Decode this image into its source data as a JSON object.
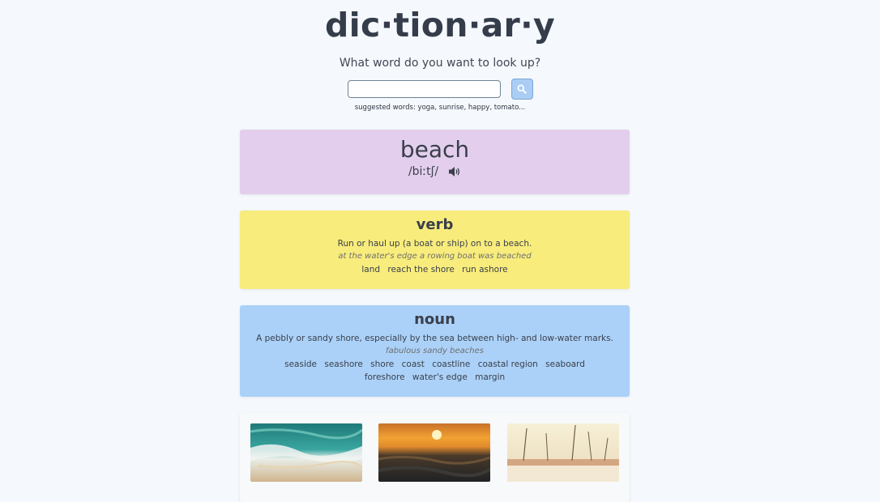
{
  "header": {
    "logo": "dic·tion·ar·y",
    "prompt": "What word do you want to look up?",
    "search": {
      "value": "",
      "placeholder": ""
    },
    "search_icon": "search-icon",
    "hint": "suggested words: yoga, sunrise, happy, tomato..."
  },
  "word": {
    "text": "beach",
    "phonetic": "/biːtʃ/",
    "audio_icon": "speaker-icon"
  },
  "meanings": [
    {
      "part_of_speech": "verb",
      "definition": "Run or haul up (a boat or ship) on to a beach.",
      "example": "at the water's edge a rowing boat was beached",
      "synonyms": [
        "land",
        "reach the shore",
        "run ashore"
      ]
    },
    {
      "part_of_speech": "noun",
      "definition": "A pebbly or sandy shore, especially by the sea between high- and low-water marks.",
      "example": "fabulous sandy beaches",
      "synonyms": [
        "seaside",
        "seashore",
        "shore",
        "coast",
        "coastline",
        "coastal region",
        "seaboard",
        "foreshore",
        "water's edge",
        "margin"
      ]
    }
  ],
  "photos": [
    "ocean waves aerial",
    "sunset over sea",
    "palm trees beach"
  ],
  "colors": {
    "word_card": "#e3cfed",
    "verb_card": "#f8ec7c",
    "noun_card": "#abd1f8",
    "search_button": "#a9cdf4",
    "background": "#f5f9fd"
  }
}
